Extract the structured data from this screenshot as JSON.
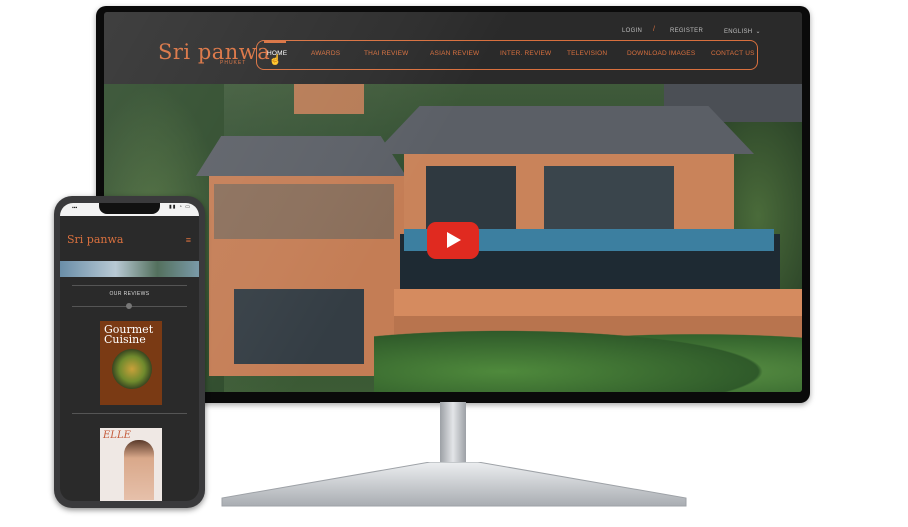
{
  "desktop": {
    "logo": "Sri panwa",
    "logo_sub": "PHUKET",
    "util": {
      "login": "LOGIN",
      "register": "REGISTER",
      "language": "ENGLISH",
      "separator": "/"
    },
    "nav": [
      "HOME",
      "AWARDS",
      "THAI REVIEW",
      "ASIAN REVIEW",
      "INTER. REVIEW",
      "TELEVISION",
      "DOWNLOAD IMAGES",
      "CONTACT US"
    ],
    "active_nav": "HOME",
    "video": {
      "play_icon": "play-icon",
      "color": "#e02a20"
    }
  },
  "mobile": {
    "logo": "Sri panwa",
    "menu_icon": "≡",
    "section_title": "OUR REVIEWS",
    "magazine1": {
      "title_line1": "Gourmet",
      "title_line2": "Cuisine"
    },
    "magazine2": {
      "title": "ELLE"
    }
  },
  "colors": {
    "accent": "#d9703e",
    "header_bg": "#2a2a2a",
    "play": "#e02a20"
  }
}
